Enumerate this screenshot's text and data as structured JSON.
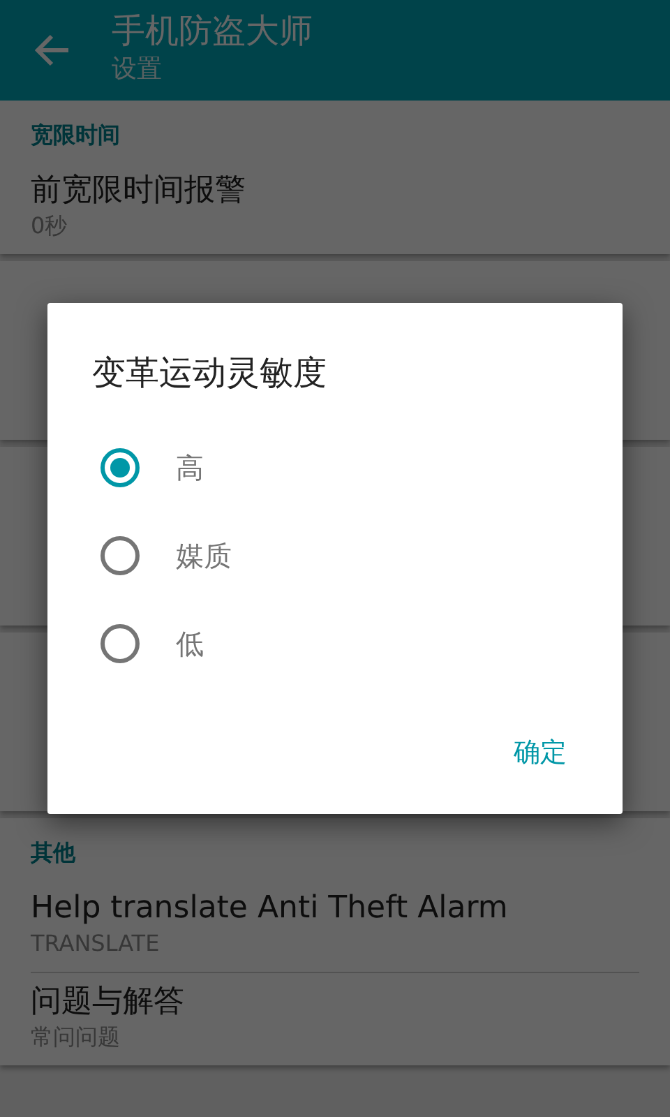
{
  "app_bar": {
    "title": "手机防盗大师",
    "subtitle": "设置"
  },
  "sections": [
    {
      "header": "宽限时间",
      "items": [
        {
          "title": "前宽限时间报警",
          "summary": "0秒"
        }
      ]
    },
    {
      "header": "其他",
      "items": [
        {
          "title": "Help translate Anti Theft Alarm",
          "summary": "TRANSLATE"
        },
        {
          "title": "问题与解答",
          "summary": "常问问题"
        }
      ]
    }
  ],
  "dialog": {
    "title": "变革运动灵敏度",
    "options": [
      {
        "label": "高",
        "selected": true
      },
      {
        "label": "媒质",
        "selected": false
      },
      {
        "label": "低",
        "selected": false
      }
    ],
    "button": "确定"
  }
}
